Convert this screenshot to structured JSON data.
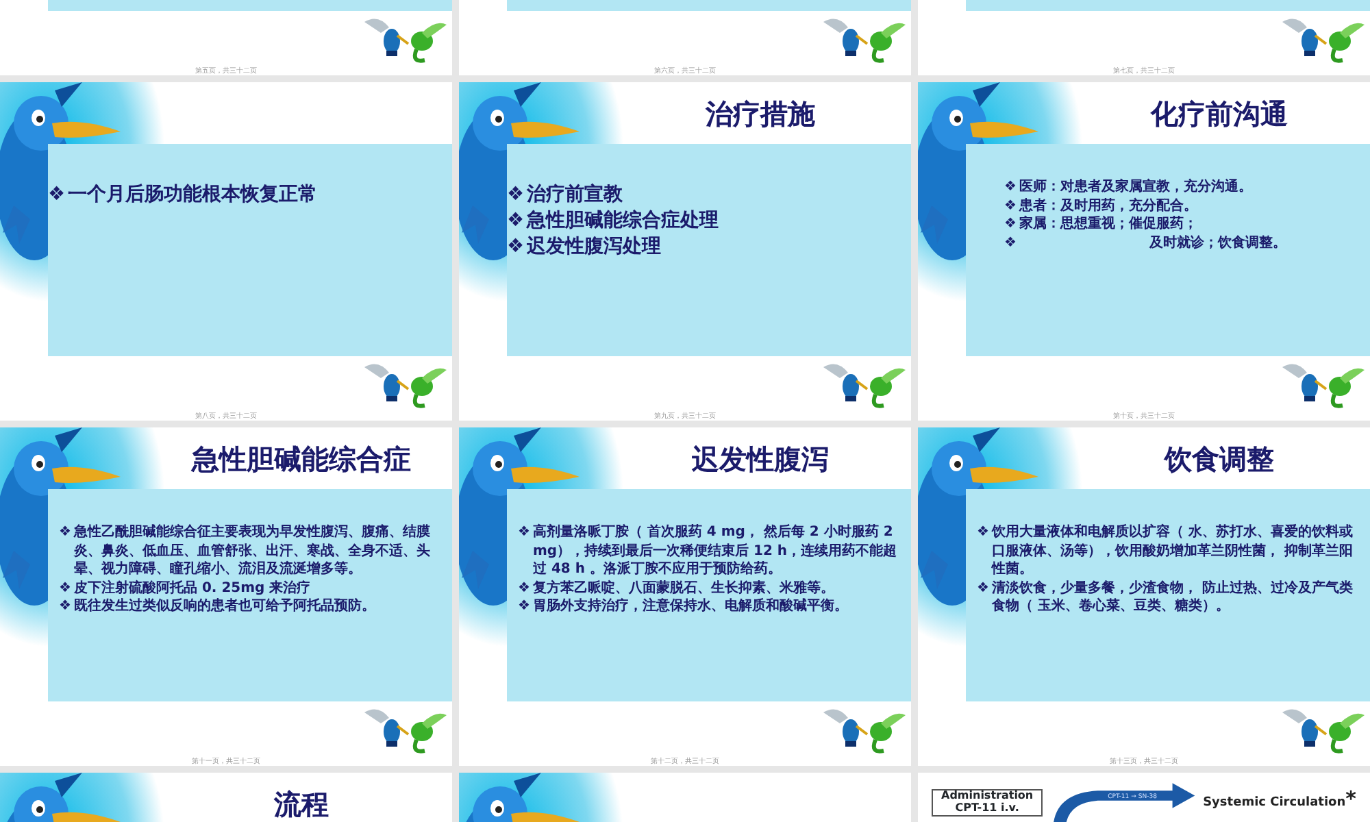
{
  "slides": [
    {
      "kind": "tail",
      "footer": "第五页，共三十二页"
    },
    {
      "kind": "tail",
      "footer": "第六页，共三十二页"
    },
    {
      "kind": "tail",
      "footer": "第七页，共三十二页"
    },
    {
      "kind": "large",
      "bullets": [
        {
          "marker": "❖",
          "text": "一个月后肠功能根本恢复正常"
        }
      ],
      "footer": "第八页，共三十二页"
    },
    {
      "kind": "large",
      "title": "治疗措施",
      "bullets": [
        {
          "marker": "❖",
          "text": "治疗前宣教"
        },
        {
          "marker": "❖",
          "text": "急性胆碱能综合症处理"
        },
        {
          "marker": "❖",
          "text": "迟发性腹泻处理"
        }
      ],
      "footer": "第九页，共三十二页"
    },
    {
      "kind": "medium",
      "title": "化疗前沟通",
      "bullets": [
        {
          "marker": "❖",
          "text": "医师：对患者及家属宣教，充分沟通。"
        },
        {
          "marker": "❖",
          "text": "患者：及时用药，充分配合。"
        },
        {
          "marker": "❖",
          "text": "家属：思想重视；催促服药；"
        },
        {
          "marker": "❖",
          "text": "及时就诊；饮食调整。"
        }
      ],
      "footer": "第十页，共三十二页"
    },
    {
      "kind": "small",
      "title": "急性胆碱能综合症",
      "bullets": [
        {
          "marker": "❖",
          "text": "急性乙酰胆碱能综合征主要表现为早发性腹泻、腹痛、结膜炎、鼻炎、低血压、血管舒张、出汗、寒战、全身不适、头晕、视力障碍、瞳孔缩小、流泪及流涎增多等。"
        },
        {
          "marker": "❖",
          "text": "皮下注射硫酸阿托品 0. 25mg 来治疗"
        },
        {
          "marker": "❖",
          "text": "既往发生过类似反响的患者也可给予阿托品预防。"
        }
      ],
      "footer": "第十一页，共三十二页"
    },
    {
      "kind": "small",
      "title": "迟发性腹泻",
      "bullets": [
        {
          "marker": "❖",
          "text": "高剂量洛哌丁胺（ 首次服药 4 mg， 然后每 2 小时服药 2 mg），持续到最后一次稀便结束后 12 h，连续用药不能超过 48 h 。洛派丁胺不应用于预防给药。"
        },
        {
          "marker": "❖",
          "text": "复方苯乙哌啶、八面蒙脱石、生长抑素、米雅等。"
        },
        {
          "marker": "❖",
          "text": "胃肠外支持治疗，注意保持水、电解质和酸碱平衡。"
        }
      ],
      "footer": "第十二页，共三十二页"
    },
    {
      "kind": "small",
      "title": "饮食调整",
      "bullets": [
        {
          "marker": "❖",
          "text": "饮用大量液体和电解质以扩容（ 水、苏打水、喜爱的饮料或口服液体、汤等），饮用酸奶增加革兰阴性菌， 抑制革兰阳性菌。"
        },
        {
          "marker": "❖",
          "text": "清淡饮食，少量多餐，少渣食物， 防止过热、过冷及产气类食物（ 玉米、卷心菜、豆类、糖类）。"
        }
      ],
      "footer": "第十三页，共三十二页"
    },
    {
      "kind": "head",
      "title": "流程"
    },
    {
      "kind": "head"
    },
    {
      "kind": "diagram",
      "box": [
        "Administration",
        "CPT-11 i.v."
      ],
      "arrow_label": "CPT-11 → SN-38",
      "target": "Systemic Circulation",
      "target_mark": "*"
    }
  ]
}
